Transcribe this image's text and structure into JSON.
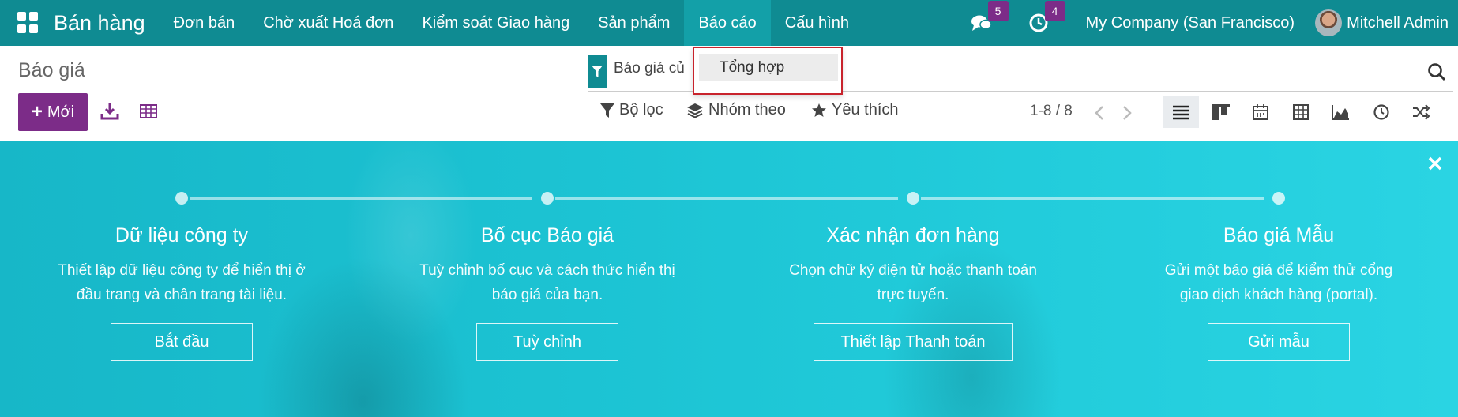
{
  "navbar": {
    "brand": "Bán hàng",
    "menu": [
      "Đơn bán",
      "Chờ xuất Hoá đơn",
      "Kiểm soát Giao hàng",
      "Sản phẩm",
      "Báo cáo",
      "Cấu hình"
    ],
    "active_menu": "Báo cáo",
    "messages_count": "5",
    "activities_count": "4",
    "company": "My Company (San Francisco)",
    "user": "Mitchell Admin",
    "color": "#0f8b92"
  },
  "dropdown": {
    "items": [
      "Tổng hợp"
    ]
  },
  "control_panel": {
    "title": "Báo giá",
    "new_button": "Mới",
    "search_facet": "Báo giá củ",
    "filters": "Bộ lọc",
    "group_by": "Nhóm theo",
    "favorites": "Yêu thích",
    "pager": "1-8 / 8",
    "accent": "#7c2c88"
  },
  "onboarding": {
    "steps": [
      {
        "title": "Dữ liệu công ty",
        "desc_line1": "Thiết lập dữ liệu công ty để hiển thị ở",
        "desc_line2": "đầu trang và chân trang tài liệu.",
        "button": "Bắt đầu"
      },
      {
        "title": "Bố cục Báo giá",
        "desc_line1": "Tuỳ chỉnh bố cục và cách thức hiển thị",
        "desc_line2": "báo giá của bạn.",
        "button": "Tuỳ chỉnh"
      },
      {
        "title": "Xác nhận đơn hàng",
        "desc_line1": "Chọn chữ ký điện tử hoặc thanh toán",
        "desc_line2": "trực tuyến.",
        "button": "Thiết lập Thanh toán"
      },
      {
        "title": "Báo giá Mẫu",
        "desc_line1": "Gửi một báo giá để kiểm thử cổng",
        "desc_line2": "giao dịch khách hàng (portal).",
        "button": "Gửi mẫu"
      }
    ]
  }
}
